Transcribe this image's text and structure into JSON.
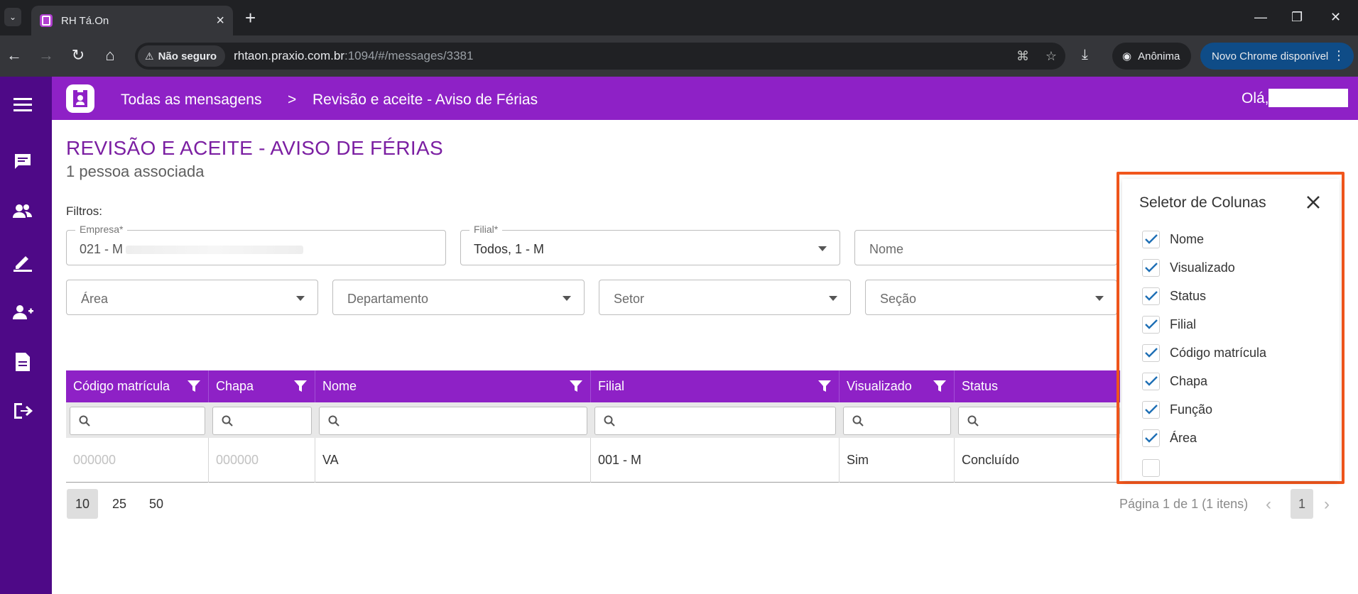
{
  "browser": {
    "tab_title": "RH Tá.On",
    "security_label": "Não seguro",
    "url_host": "rhtaon.praxio.com.br",
    "url_path": ":1094/#/messages/3381",
    "incognito_label": "Anônima",
    "update_label": "Novo Chrome disponível"
  },
  "header": {
    "breadcrumb_root": "Todas as mensagens",
    "breadcrumb_separator": ">",
    "breadcrumb_current": "Revisão e aceite - Aviso de Férias",
    "greeting": "Olá,"
  },
  "page": {
    "title": "REVISÃO E ACEITE - AVISO DE FÉRIAS",
    "subtitle": "1 pessoa associada",
    "filters_label": "Filtros:"
  },
  "filters": {
    "empresa": {
      "label": "Empresa*",
      "value": "021 - M"
    },
    "filial": {
      "label": "Filial*",
      "value": "Todos, 1 - M"
    },
    "nome": {
      "placeholder": "Nome"
    },
    "area": {
      "placeholder": "Área"
    },
    "departamento": {
      "placeholder": "Departamento"
    },
    "setor": {
      "placeholder": "Setor"
    },
    "secao": {
      "placeholder": "Seção"
    }
  },
  "grid": {
    "columns": [
      "Código matrícula",
      "Chapa",
      "Nome",
      "Filial",
      "Visualizado",
      "Status"
    ],
    "rows": [
      [
        "000000",
        "000000",
        "VA",
        "001 - M",
        "Sim",
        "Concluído"
      ]
    ]
  },
  "pager": {
    "sizes": [
      "10",
      "25",
      "50"
    ],
    "active_size": "10",
    "info": "Página 1 de 1 (1 itens)",
    "current_page": "1"
  },
  "column_chooser": {
    "title": "Seletor de Colunas",
    "options": [
      "Nome",
      "Visualizado",
      "Status",
      "Filial",
      "Código matrícula",
      "Chapa",
      "Função",
      "Área"
    ]
  },
  "colors": {
    "brand_purple": "#8e21c6",
    "sidebar_purple": "#4e0987",
    "title_purple": "#7b1fa2",
    "highlight_orange": "#f1561c",
    "check_blue": "#1e6fb5"
  }
}
